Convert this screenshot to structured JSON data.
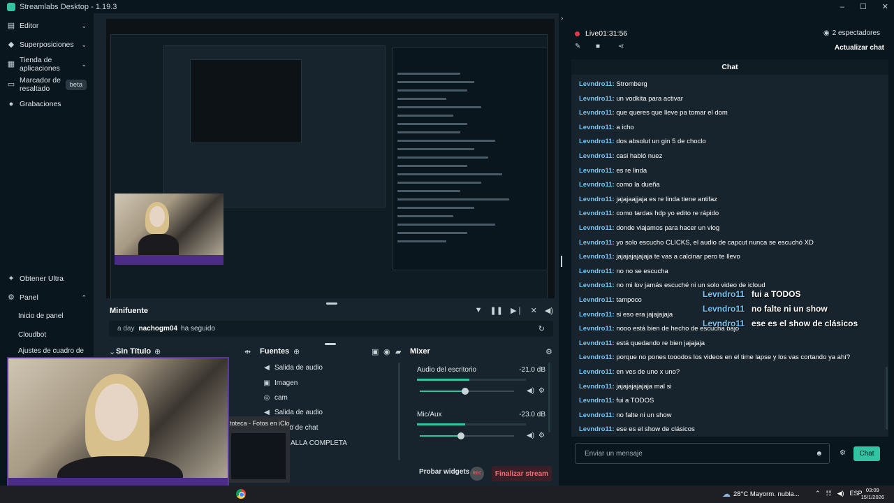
{
  "window": {
    "title": "Streamlabs Desktop - 1.19.3",
    "controls": [
      "–",
      "☐",
      "✕"
    ]
  },
  "sidebar": {
    "items": [
      {
        "label": "Editor",
        "icon": "layout-icon"
      },
      {
        "label": "Superposiciones",
        "icon": "overlay-icon"
      },
      {
        "label": "Tienda de aplicaciones",
        "icon": "store-icon"
      },
      {
        "label": "Marcador de resaltado",
        "icon": "highlight-icon",
        "badge": "beta"
      },
      {
        "label": "Grabaciones",
        "icon": "recordings-icon"
      }
    ],
    "bottom": {
      "ultra": "Obtener Ultra",
      "panel": "Panel",
      "panel_items": [
        "Inicio de panel",
        "Cloudbot",
        "Ajustes de cuadro de"
      ]
    }
  },
  "minifuente": {
    "title": "Minifuente",
    "event": {
      "time": "a day",
      "user": "nachogm04",
      "text": "ha seguido"
    }
  },
  "scenes": {
    "title": "Sin Título"
  },
  "sources": {
    "title": "Fuentes",
    "items": [
      {
        "label": "Salida de audio",
        "icon": "speaker-icon"
      },
      {
        "label": "Imagen",
        "icon": "image-icon"
      },
      {
        "label": "cam",
        "icon": "camera-icon"
      },
      {
        "label": "Salida de audio",
        "icon": "speaker-icon"
      }
    ],
    "overlapped": [
      "ro de chat",
      "ALLA COMPLETA"
    ]
  },
  "mixer": {
    "title": "Mixer",
    "channels": [
      {
        "name": "Audio del escritorio",
        "db": "-21.0 dB",
        "level": 0.48
      },
      {
        "name": "Mic/Aux",
        "db": "-23.0 dB",
        "level": 0.44
      }
    ]
  },
  "bottom_bar": {
    "test_widgets": "Probar widgets",
    "rec": "REC",
    "end_stream": "Finalizar stream"
  },
  "popup": {
    "title": "toteca - Fotos en iClo..."
  },
  "right_panel": {
    "live": "Live01:31:56",
    "viewers": "2 espectadores",
    "refresh_chat": "Actualizar chat",
    "chat_title": "Chat",
    "messages": [
      {
        "user": "Levndro11:",
        "text": " Stromberg"
      },
      {
        "user": "Levndro11:",
        "text": " un vodkita para activar"
      },
      {
        "user": "Levndro11:",
        "text": " que queres que lleve pa tomar el dom"
      },
      {
        "user": "Levndro11:",
        "text": " a icho"
      },
      {
        "user": "Levndro11:",
        "text": " dos absolut un gin 5 de choclo"
      },
      {
        "user": "Levndro11:",
        "text": " casi habló nuez"
      },
      {
        "user": "Levndro11:",
        "text": " es re linda"
      },
      {
        "user": "Levndro11:",
        "text": " como la dueña"
      },
      {
        "user": "Levndro11:",
        "text": " jajajaajjaja es re linda tiene antifaz"
      },
      {
        "user": "Levndro11:",
        "text": " como tardas hdp yo edito re rápido"
      },
      {
        "user": "Levndro11:",
        "text": " donde viajamos para hacer un vlog"
      },
      {
        "user": "Levndro11:",
        "text": " yo solo escucho CLICKS, el audio de capcut nunca se escuchó XD"
      },
      {
        "user": "Levndro11:",
        "text": " jajajajajajaja te vas a calcinar pero te llevo"
      },
      {
        "user": "Levndro11:",
        "text": " no no se escucha"
      },
      {
        "user": "Levndro11:",
        "text": " no mi lov jamás escuché ni un solo video de icloud"
      },
      {
        "user": "Levndro11:",
        "text": " tampoco"
      },
      {
        "user": "Levndro11:",
        "text": " si eso era jajajajaja"
      },
      {
        "user": "Levndro11:",
        "text": " nooo está bien de hecho de escucha bajo"
      },
      {
        "user": "Levndro11:",
        "text": " está quedando re bien jajajaja"
      },
      {
        "user": "Levndro11:",
        "text": " porque no pones tooodos los videos en el time lapse y los vas cortando ya ahí?"
      },
      {
        "user": "Levndro11:",
        "text": " en ves de uno x uno?"
      },
      {
        "user": "Levndro11:",
        "text": " jajajajajajaja mal si"
      },
      {
        "user": "Levndro11:",
        "text": " fui a TODOS"
      },
      {
        "user": "Levndro11:",
        "text": " no falte ni un show"
      },
      {
        "user": "Levndro11:",
        "text": " ese es el show de clásicos"
      }
    ],
    "overlay_messages": [
      {
        "user": "Levndro11",
        "text": "fui a TODOS"
      },
      {
        "user": "Levndro11",
        "text": "no falte ni un show"
      },
      {
        "user": "Levndro11",
        "text": "ese es el show de clásicos"
      }
    ],
    "input_placeholder": "Enviar un mensaje",
    "send": "Chat"
  },
  "taskbar": {
    "weather": "28°C  Mayorm. nubla...",
    "lang": "ESP",
    "time": "03:09",
    "date": "15/1/2026"
  },
  "colors": {
    "accent": "#31c3a2",
    "live": "#e0394a",
    "username": "#74c4f5",
    "danger": "#f26f76"
  }
}
